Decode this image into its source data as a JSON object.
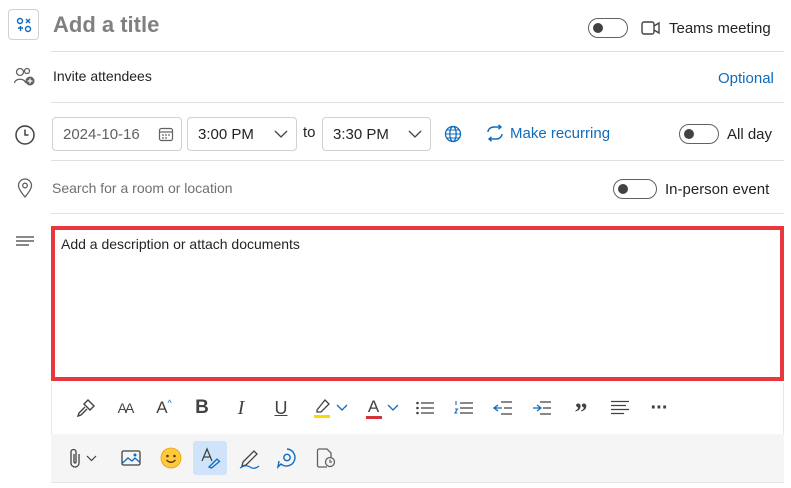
{
  "header": {
    "title_placeholder": "Add a title",
    "teams_label": "Teams meeting"
  },
  "attendees": {
    "placeholder": "Invite attendees",
    "optional_label": "Optional"
  },
  "datetime": {
    "date": "2024-10-16",
    "start_time": "3:00 PM",
    "to_label": "to",
    "end_time": "3:30 PM",
    "recurring_label": "Make recurring",
    "all_day_label": "All day"
  },
  "location": {
    "placeholder": "Search for a room or location",
    "in_person_label": "In-person event"
  },
  "description": {
    "placeholder": "Add a description or attach documents"
  },
  "toolbar": {
    "row1": [
      "format-painter-icon",
      "font-size-icon",
      "grow-font-icon",
      "bold-icon",
      "italic-icon",
      "underline-icon",
      "highlight-icon",
      "font-color-icon",
      "bullets-icon",
      "numbering-icon",
      "decrease-indent-icon",
      "increase-indent-icon",
      "quote-icon",
      "align-icon",
      "more-icon"
    ],
    "row2": [
      "attach-icon",
      "image-icon",
      "emoji-icon",
      "editor-icon",
      "signature-icon",
      "loop-icon",
      "scheduling-icon"
    ],
    "bold_glyph": "B",
    "italic_glyph": "I",
    "underline_glyph": "U",
    "font_color_glyph": "A",
    "quote_glyph": "”",
    "more_glyph": "···",
    "font_size_glyph": "AA",
    "grow_font_glyph": "A"
  },
  "colors": {
    "accent": "#0f6cbd",
    "highlight_outline": "#e8383d",
    "highlight_yellow": "#ffd800",
    "font_color_red": "#d13438",
    "active_button_bg": "#cfe4fa"
  }
}
